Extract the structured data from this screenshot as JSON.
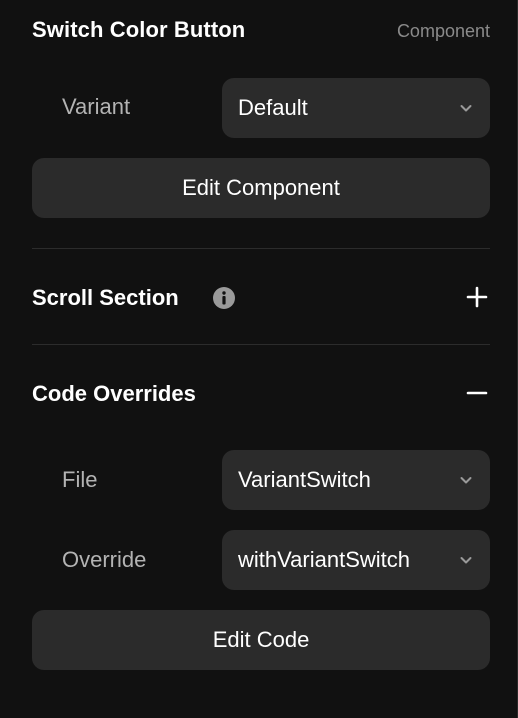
{
  "component": {
    "title": "Switch Color Button",
    "type_label": "Component",
    "variant_label": "Variant",
    "variant_value": "Default",
    "edit_button_label": "Edit Component"
  },
  "scroll_section": {
    "title": "Scroll Section",
    "info_icon": "info-circle-icon",
    "toggle_icon": "plus-icon"
  },
  "code_overrides": {
    "title": "Code Overrides",
    "toggle_icon": "minus-icon",
    "file_label": "File",
    "file_value": "VariantSwitch",
    "override_label": "Override",
    "override_value": "withVariantSwitch",
    "edit_button_label": "Edit Code"
  },
  "colors": {
    "background": "#111111",
    "control_bg": "#2b2b2b",
    "secondary_text": "#b3b3b3",
    "muted_text": "#8a8a8a",
    "primary_text": "#ffffff"
  }
}
